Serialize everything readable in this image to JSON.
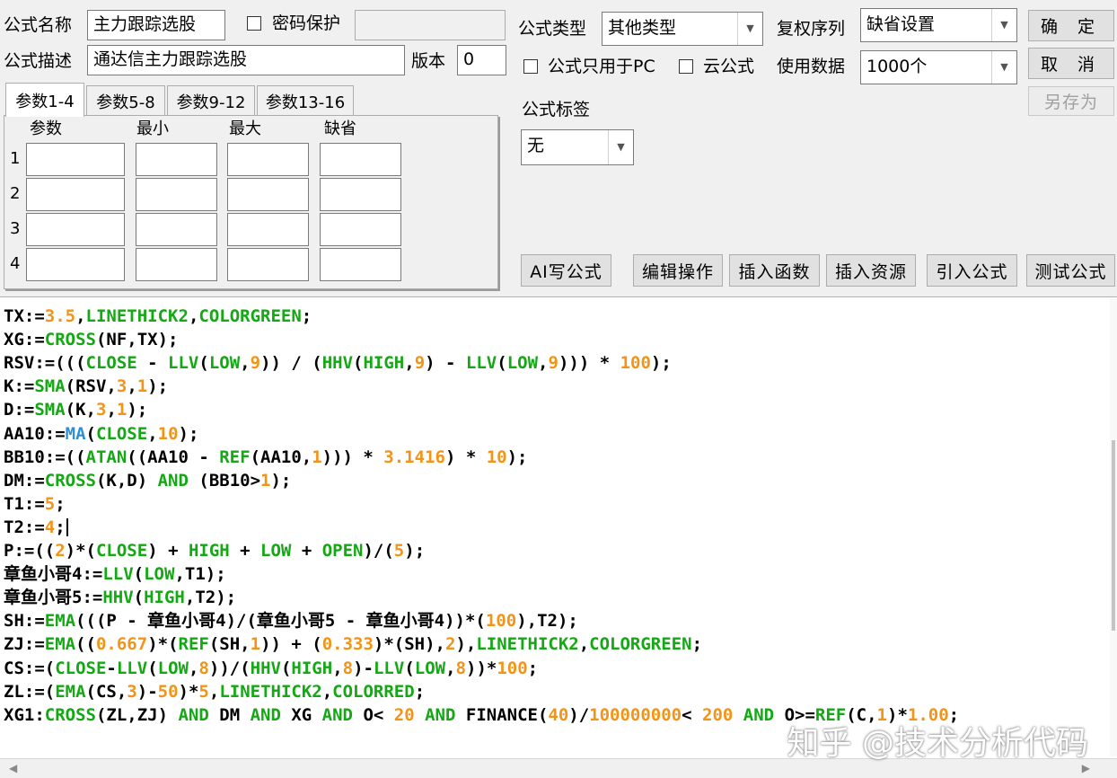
{
  "header": {
    "name_label": "公式名称",
    "name_value": "主力跟踪选股",
    "password_label": "密码保护",
    "password_checked": false,
    "desc_label": "公式描述",
    "desc_value": "通达信主力跟踪选股",
    "version_label": "版本",
    "version_value": "0",
    "type_label": "公式类型",
    "type_value": "其他类型",
    "rights_label": "复权序列",
    "rights_value": "缺省设置",
    "pc_only_label": "公式只用于PC",
    "pc_only_checked": false,
    "cloud_label": "云公式",
    "cloud_checked": false,
    "data_label": "使用数据",
    "data_value": "1000个",
    "tag_label": "公式标签",
    "tag_value": "无"
  },
  "buttons": {
    "ok": "确 定",
    "cancel": "取 消",
    "save_as": "另存为",
    "ai": "AI写公式",
    "edit_ops": "编辑操作",
    "insert_func": "插入函数",
    "insert_res": "插入资源",
    "import": "引入公式",
    "test": "测试公式"
  },
  "tabs": [
    "参数1-4",
    "参数5-8",
    "参数9-12",
    "参数13-16"
  ],
  "active_tab": 0,
  "param_headers": [
    "参数",
    "最小",
    "最大",
    "缺省"
  ],
  "param_rows": [
    "1",
    "2",
    "3",
    "4"
  ],
  "code_lines": [
    [
      {
        "t": "TX:="
      },
      {
        "t": "3.5",
        "c": "o"
      },
      {
        "t": ","
      },
      {
        "t": "LINETHICK2",
        "c": "g"
      },
      {
        "t": ","
      },
      {
        "t": "COLORGREEN",
        "c": "g"
      },
      {
        "t": ";"
      }
    ],
    [
      {
        "t": "XG:="
      },
      {
        "t": "CROSS",
        "c": "g"
      },
      {
        "t": "(NF,TX);"
      }
    ],
    [
      {
        "t": "RSV:=((("
      },
      {
        "t": "CLOSE",
        "c": "g"
      },
      {
        "t": " - "
      },
      {
        "t": "LLV",
        "c": "g"
      },
      {
        "t": "("
      },
      {
        "t": "LOW",
        "c": "g"
      },
      {
        "t": ","
      },
      {
        "t": "9",
        "c": "o"
      },
      {
        "t": ")) / ("
      },
      {
        "t": "HHV",
        "c": "g"
      },
      {
        "t": "("
      },
      {
        "t": "HIGH",
        "c": "g"
      },
      {
        "t": ","
      },
      {
        "t": "9",
        "c": "o"
      },
      {
        "t": ") - "
      },
      {
        "t": "LLV",
        "c": "g"
      },
      {
        "t": "("
      },
      {
        "t": "LOW",
        "c": "g"
      },
      {
        "t": ","
      },
      {
        "t": "9",
        "c": "o"
      },
      {
        "t": "))) * "
      },
      {
        "t": "100",
        "c": "o"
      },
      {
        "t": ");"
      }
    ],
    [
      {
        "t": "K:="
      },
      {
        "t": "SMA",
        "c": "g"
      },
      {
        "t": "(RSV,"
      },
      {
        "t": "3",
        "c": "o"
      },
      {
        "t": ","
      },
      {
        "t": "1",
        "c": "o"
      },
      {
        "t": ");"
      }
    ],
    [
      {
        "t": "D:="
      },
      {
        "t": "SMA",
        "c": "g"
      },
      {
        "t": "(K,"
      },
      {
        "t": "3",
        "c": "o"
      },
      {
        "t": ","
      },
      {
        "t": "1",
        "c": "o"
      },
      {
        "t": ");"
      }
    ],
    [
      {
        "t": "AA10:="
      },
      {
        "t": "MA",
        "c": "b"
      },
      {
        "t": "("
      },
      {
        "t": "CLOSE",
        "c": "g"
      },
      {
        "t": ","
      },
      {
        "t": "10",
        "c": "o"
      },
      {
        "t": ");"
      }
    ],
    [
      {
        "t": "BB10:=(("
      },
      {
        "t": "ATAN",
        "c": "g"
      },
      {
        "t": "((AA10 - "
      },
      {
        "t": "REF",
        "c": "g"
      },
      {
        "t": "(AA10,"
      },
      {
        "t": "1",
        "c": "o"
      },
      {
        "t": "))) * "
      },
      {
        "t": "3.1416",
        "c": "o"
      },
      {
        "t": ") * "
      },
      {
        "t": "10",
        "c": "o"
      },
      {
        "t": ");"
      }
    ],
    [
      {
        "t": "DM:="
      },
      {
        "t": "CROSS",
        "c": "g"
      },
      {
        "t": "(K,D) "
      },
      {
        "t": "AND",
        "c": "g"
      },
      {
        "t": " (BB10>"
      },
      {
        "t": "1",
        "c": "o"
      },
      {
        "t": ");"
      }
    ],
    [
      {
        "t": "T1:="
      },
      {
        "t": "5",
        "c": "o"
      },
      {
        "t": ";"
      }
    ],
    [
      {
        "t": "T2:="
      },
      {
        "t": "4",
        "c": "o"
      },
      {
        "t": ";"
      }
    ],
    [
      {
        "t": "P:=(("
      },
      {
        "t": "2",
        "c": "o"
      },
      {
        "t": ")*("
      },
      {
        "t": "CLOSE",
        "c": "g"
      },
      {
        "t": ") + "
      },
      {
        "t": "HIGH",
        "c": "g"
      },
      {
        "t": " + "
      },
      {
        "t": "LOW",
        "c": "g"
      },
      {
        "t": " + "
      },
      {
        "t": "OPEN",
        "c": "g"
      },
      {
        "t": ")/("
      },
      {
        "t": "5",
        "c": "o"
      },
      {
        "t": ");"
      }
    ],
    [
      {
        "t": "章鱼小哥4:="
      },
      {
        "t": "LLV",
        "c": "g"
      },
      {
        "t": "("
      },
      {
        "t": "LOW",
        "c": "g"
      },
      {
        "t": ",T1);"
      }
    ],
    [
      {
        "t": "章鱼小哥5:="
      },
      {
        "t": "HHV",
        "c": "g"
      },
      {
        "t": "("
      },
      {
        "t": "HIGH",
        "c": "g"
      },
      {
        "t": ",T2);"
      }
    ],
    [
      {
        "t": "SH:="
      },
      {
        "t": "EMA",
        "c": "g"
      },
      {
        "t": "(((P - 章鱼小哥4)/(章鱼小哥5 - 章鱼小哥4))*("
      },
      {
        "t": "100",
        "c": "o"
      },
      {
        "t": "),T2);"
      }
    ],
    [
      {
        "t": "ZJ:="
      },
      {
        "t": "EMA",
        "c": "g"
      },
      {
        "t": "(("
      },
      {
        "t": "0.667",
        "c": "o"
      },
      {
        "t": ")*("
      },
      {
        "t": "REF",
        "c": "g"
      },
      {
        "t": "(SH,"
      },
      {
        "t": "1",
        "c": "o"
      },
      {
        "t": ")) + ("
      },
      {
        "t": "0.333",
        "c": "o"
      },
      {
        "t": ")*(SH),"
      },
      {
        "t": "2",
        "c": "o"
      },
      {
        "t": "),"
      },
      {
        "t": "LINETHICK2",
        "c": "g"
      },
      {
        "t": ","
      },
      {
        "t": "COLORGREEN",
        "c": "g"
      },
      {
        "t": ";"
      }
    ],
    [
      {
        "t": "CS:=("
      },
      {
        "t": "CLOSE",
        "c": "g"
      },
      {
        "t": "-"
      },
      {
        "t": "LLV",
        "c": "g"
      },
      {
        "t": "("
      },
      {
        "t": "LOW",
        "c": "g"
      },
      {
        "t": ","
      },
      {
        "t": "8",
        "c": "o"
      },
      {
        "t": "))/("
      },
      {
        "t": "HHV",
        "c": "g"
      },
      {
        "t": "("
      },
      {
        "t": "HIGH",
        "c": "g"
      },
      {
        "t": ","
      },
      {
        "t": "8",
        "c": "o"
      },
      {
        "t": ")-"
      },
      {
        "t": "LLV",
        "c": "g"
      },
      {
        "t": "("
      },
      {
        "t": "LOW",
        "c": "g"
      },
      {
        "t": ","
      },
      {
        "t": "8",
        "c": "o"
      },
      {
        "t": "))*"
      },
      {
        "t": "100",
        "c": "o"
      },
      {
        "t": ";"
      }
    ],
    [
      {
        "t": "ZL:=("
      },
      {
        "t": "EMA",
        "c": "g"
      },
      {
        "t": "(CS,"
      },
      {
        "t": "3",
        "c": "o"
      },
      {
        "t": ")-"
      },
      {
        "t": "50",
        "c": "o"
      },
      {
        "t": ")*"
      },
      {
        "t": "5",
        "c": "o"
      },
      {
        "t": ","
      },
      {
        "t": "LINETHICK2",
        "c": "g"
      },
      {
        "t": ","
      },
      {
        "t": "COLORRED",
        "c": "g"
      },
      {
        "t": ";"
      }
    ],
    [
      {
        "t": "XG1:"
      },
      {
        "t": "CROSS",
        "c": "g"
      },
      {
        "t": "(ZL,ZJ) "
      },
      {
        "t": "AND",
        "c": "g"
      },
      {
        "t": " DM "
      },
      {
        "t": "AND",
        "c": "g"
      },
      {
        "t": " XG "
      },
      {
        "t": "AND",
        "c": "g"
      },
      {
        "t": " O< "
      },
      {
        "t": "20",
        "c": "o"
      },
      {
        "t": " "
      },
      {
        "t": "AND",
        "c": "g"
      },
      {
        "t": " FINANCE("
      },
      {
        "t": "40",
        "c": "o"
      },
      {
        "t": ")/"
      },
      {
        "t": "100000000",
        "c": "o"
      },
      {
        "t": "< "
      },
      {
        "t": "200",
        "c": "o"
      },
      {
        "t": " "
      },
      {
        "t": "AND",
        "c": "g"
      },
      {
        "t": " O>="
      },
      {
        "t": "REF",
        "c": "g"
      },
      {
        "t": "(C,"
      },
      {
        "t": "1",
        "c": "o"
      },
      {
        "t": ")*"
      },
      {
        "t": "1.00",
        "c": "o"
      },
      {
        "t": ";"
      }
    ]
  ],
  "caret_line": 9,
  "colors": {
    "g": "#14a814",
    "o": "#f39417",
    "b": "#2d8fd6"
  },
  "watermark": "知乎 @技术分析代码"
}
